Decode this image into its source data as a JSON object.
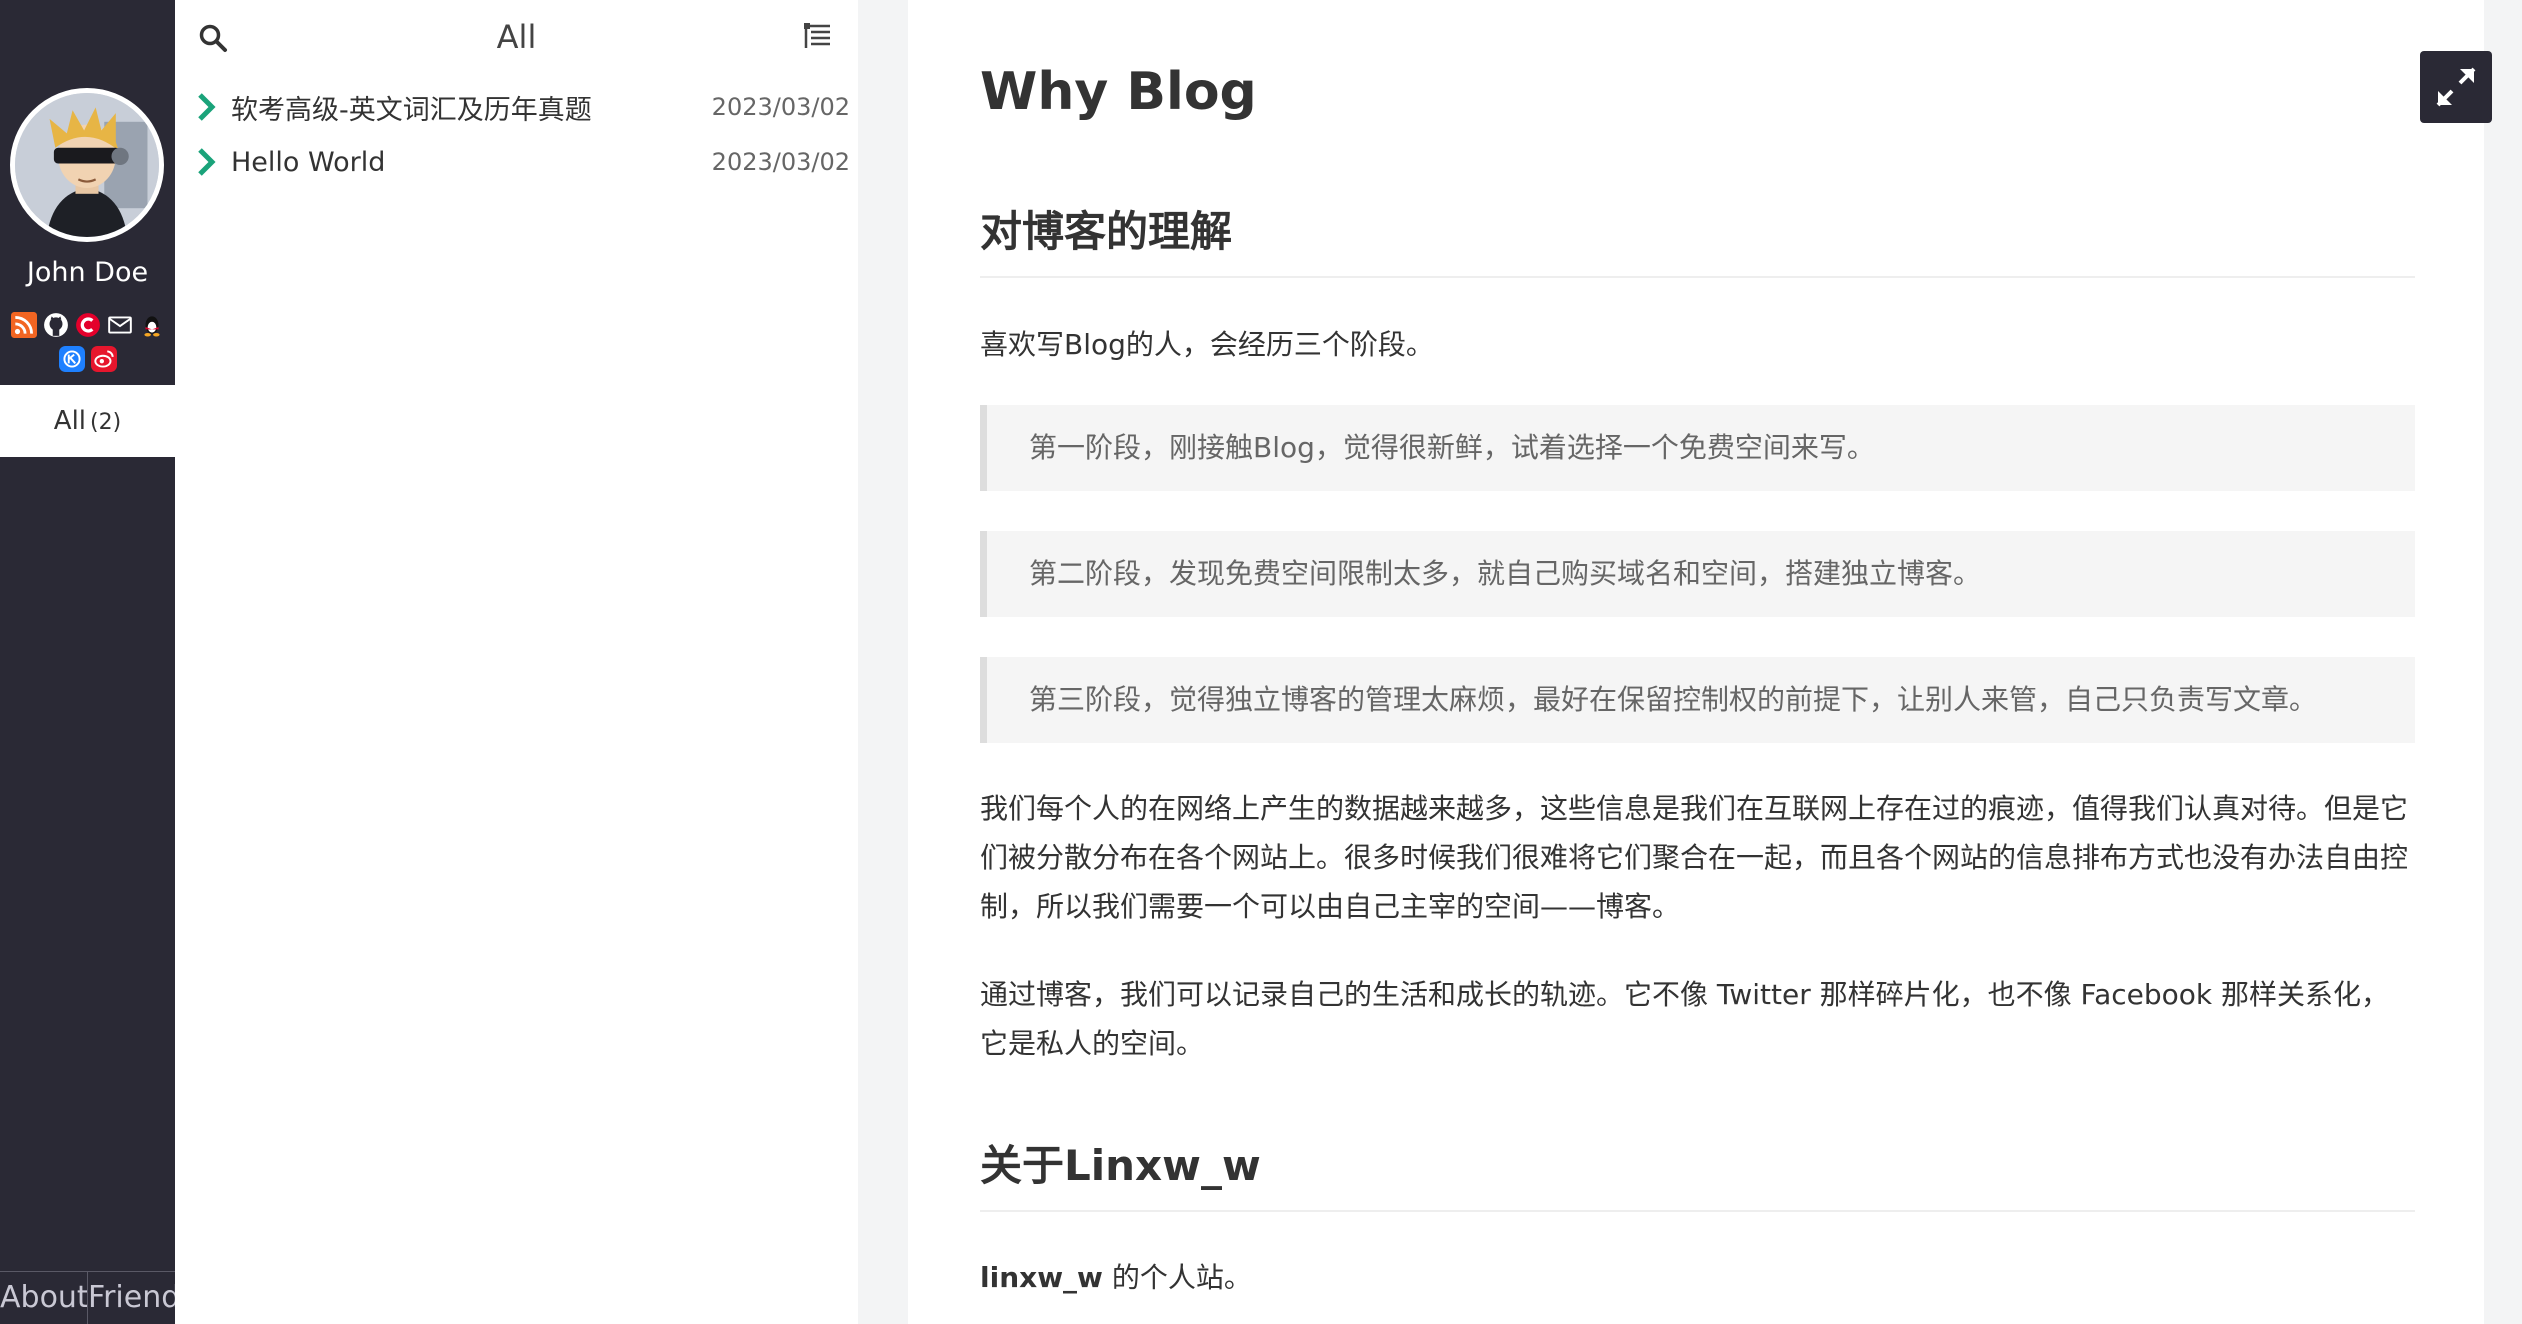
{
  "sidebar": {
    "author_name": "John Doe",
    "social_icons": [
      "rss-icon",
      "github-icon",
      "csdn-icon",
      "mail-icon",
      "qq-icon",
      "juejin-icon",
      "weibo-icon"
    ],
    "category": {
      "label": "All",
      "count": "(2)"
    },
    "footer": {
      "about": "About",
      "friend": "Friend"
    }
  },
  "post_list": {
    "title": "All",
    "posts": [
      {
        "title": "软考高级-英文词汇及历年真题",
        "date": "2023/03/02"
      },
      {
        "title": "Hello World",
        "date": "2023/03/02"
      }
    ]
  },
  "article": {
    "title": "Why Blog",
    "section1_heading": "对博客的理解",
    "intro": "喜欢写Blog的人，会经历三个阶段。",
    "quotes": [
      "第一阶段，刚接触Blog，觉得很新鲜，试着选择一个免费空间来写。",
      "第二阶段，发现免费空间限制太多，就自己购买域名和空间，搭建独立博客。",
      "第三阶段，觉得独立博客的管理太麻烦，最好在保留控制权的前提下，让别人来管，自己只负责写文章。"
    ],
    "para1": "我们每个人的在网络上产生的数据越来越多，这些信息是我们在互联网上存在过的痕迹，值得我们认真对待。但是它们被分散分布在各个网站上。很多时候我们很难将它们聚合在一起，而且各个网站的信息排布方式也没有办法自由控制，所以我们需要一个可以由自己主宰的空间——博客。",
    "para2": "通过博客，我们可以记录自己的生活和成长的轨迹。它不像 Twitter 那样碎片化，也不像 Facebook 那样关系化，它是私人的空间。",
    "section2_heading": "关于Linxw_w",
    "about_bold": "linxw_w",
    "about_rest": " 的个人站。"
  },
  "colors": {
    "sidebar_bg": "#2a2935",
    "accent_green": "#1aa37a",
    "quote_bg": "#f5f5f5",
    "gutter_bg": "#f3f4f5"
  }
}
